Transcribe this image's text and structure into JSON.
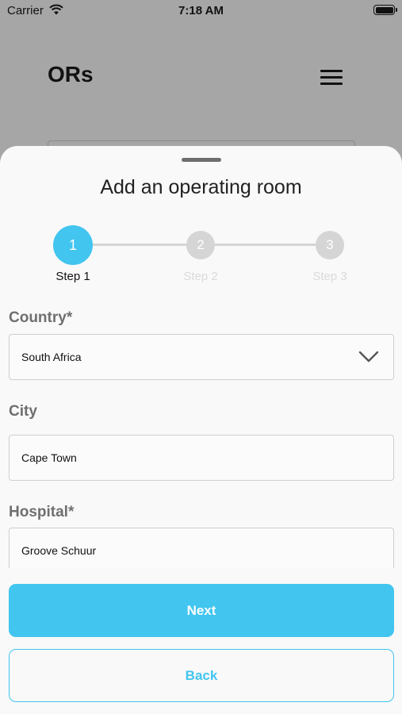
{
  "status_bar": {
    "carrier": "Carrier",
    "time": "7:18 AM"
  },
  "background_page": {
    "title": "ORs"
  },
  "sheet": {
    "title": "Add an operating room",
    "steps": [
      {
        "number": "1",
        "label": "Step 1",
        "state": "active"
      },
      {
        "number": "2",
        "label": "Step 2",
        "state": "inactive"
      },
      {
        "number": "3",
        "label": "Step 3",
        "state": "inactive"
      }
    ],
    "fields": {
      "country": {
        "label": "Country*",
        "value": "South Africa"
      },
      "city": {
        "label": "City",
        "value": "Cape Town"
      },
      "hospital": {
        "label": "Hospital*",
        "value": "Groove Schuur"
      }
    },
    "buttons": {
      "next": "Next",
      "back": "Back"
    }
  },
  "colors": {
    "accent": "#42c5ef",
    "overlay": "#a6a6a6",
    "sheet": "#f9f9f9"
  },
  "icons": [
    "wifi-icon",
    "battery-icon",
    "menu-icon",
    "chevron-down-icon"
  ]
}
